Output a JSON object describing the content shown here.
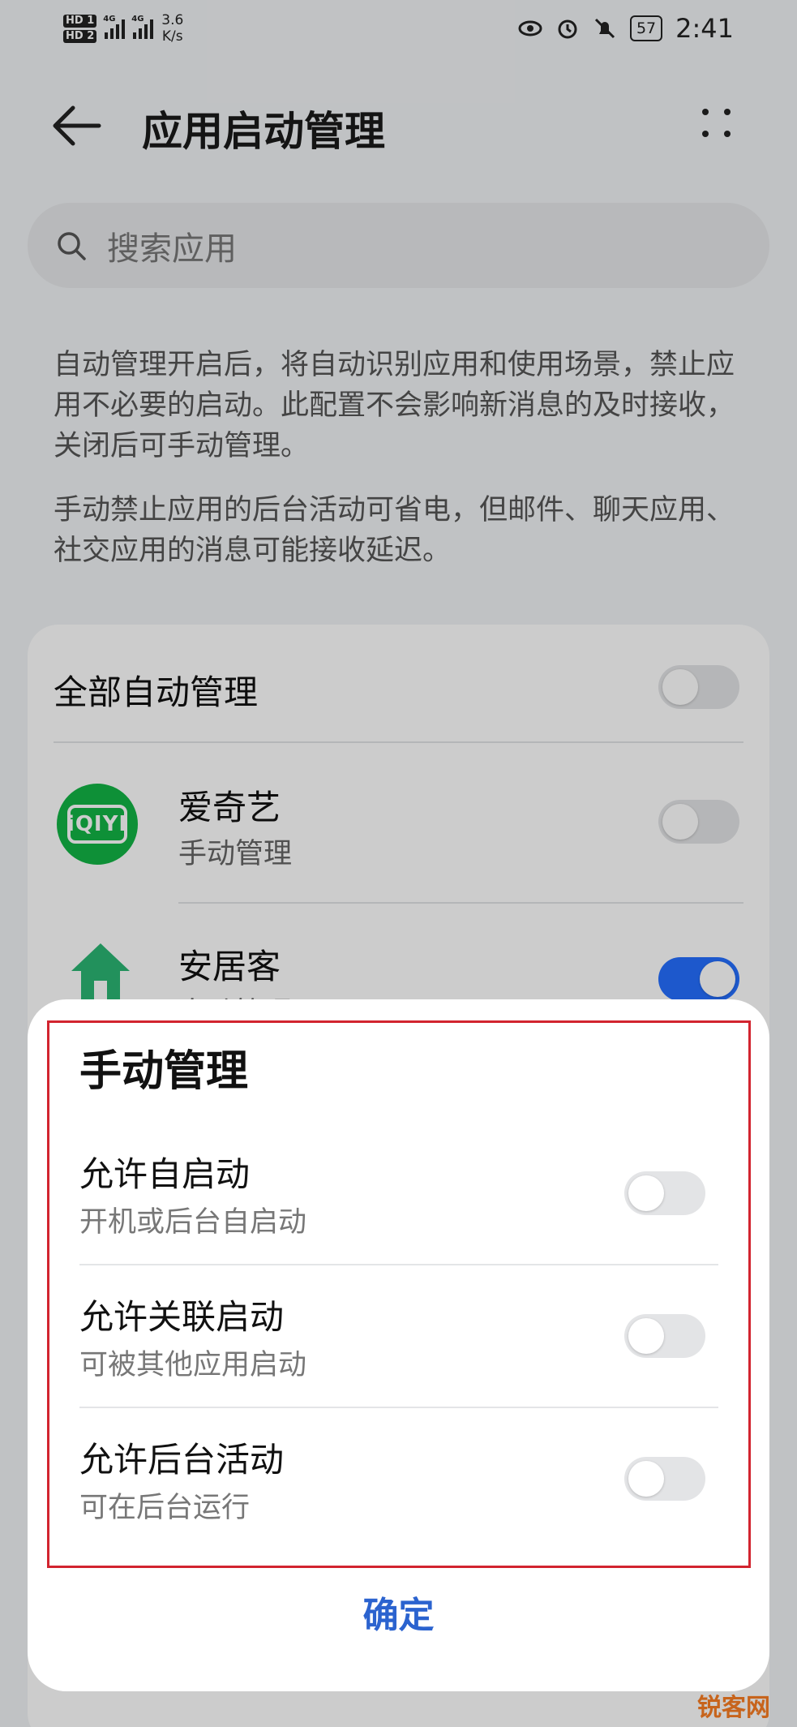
{
  "status_bar": {
    "hd1": "HD 1",
    "hd2": "HD 2",
    "net1": "4G",
    "net2": "4G",
    "speed_value": "3.6",
    "speed_unit": "K/s",
    "battery": "57",
    "time": "2:41"
  },
  "header": {
    "title": "应用启动管理"
  },
  "search": {
    "placeholder": "搜索应用"
  },
  "description": {
    "paragraph1": "自动管理开启后，将自动识别应用和使用场景，禁止应用不必要的启动。此配置不会影响新消息的及时接收，关闭后可手动管理。",
    "paragraph2": "手动禁止应用的后台活动可省电，但邮件、聊天应用、社交应用的消息可能接收延迟。"
  },
  "list": {
    "all_auto_label": "全部自动管理",
    "all_auto_on": false,
    "apps": [
      {
        "name": "爱奇艺",
        "status": "手动管理",
        "icon_text": "iQIYI",
        "on": false
      },
      {
        "name": "安居客",
        "status": "自动管理",
        "on": true
      }
    ]
  },
  "dialog": {
    "title": "手动管理",
    "options": [
      {
        "title": "允许自启动",
        "subtitle": "开机或后台自启动",
        "on": false
      },
      {
        "title": "允许关联启动",
        "subtitle": "可被其他应用启动",
        "on": false
      },
      {
        "title": "允许后台活动",
        "subtitle": "可在后台运行",
        "on": false
      }
    ],
    "confirm_label": "确定"
  },
  "watermark": "锐客网",
  "colors": {
    "accent": "#256fff",
    "confirm": "#2b63cf",
    "highlight_border": "#d2242f",
    "iqiyi_green": "#12b545",
    "anjuke_green": "#2bb673"
  }
}
